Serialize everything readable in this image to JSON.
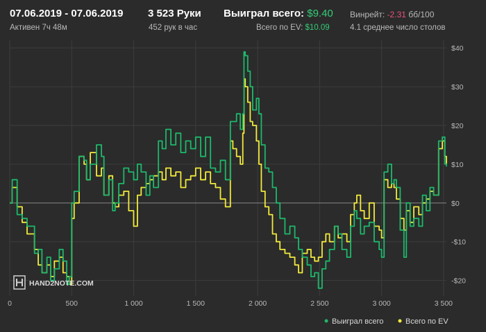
{
  "header": {
    "date_range": "07.06.2019 - 07.06.2019",
    "active": "Активен 7ч 48м",
    "hands": "3 523 Руки",
    "hands_per_hour": "452 рук в час",
    "won_label": "Выиграл всего:",
    "won_value": "$9.40",
    "ev_label": "Всего по EV:",
    "ev_value": "$10.09",
    "winrate_label": "Винрейт:",
    "winrate_value": "-2.31",
    "winrate_unit": "бб/100",
    "avg_tables": "4.1 среднее число столов"
  },
  "watermark": "HAND2NOTE.COM",
  "colors": {
    "won": "#1db86b",
    "ev": "#f2ea3c",
    "background": "#2b2b2b",
    "grid": "#3d3d3d",
    "zero_line": "#8a8a8a"
  },
  "chart_data": {
    "type": "line",
    "xlim": [
      0,
      3523
    ],
    "ylim": [
      -24,
      42
    ],
    "x_ticks": [
      {
        "value": 0,
        "label": "0"
      },
      {
        "value": 500,
        "label": "500"
      },
      {
        "value": 1000,
        "label": "1 000"
      },
      {
        "value": 1500,
        "label": "1 500"
      },
      {
        "value": 2000,
        "label": "2 000"
      },
      {
        "value": 2500,
        "label": "2 500"
      },
      {
        "value": 3000,
        "label": "3 000"
      },
      {
        "value": 3500,
        "label": "3 500"
      }
    ],
    "y_ticks": [
      {
        "value": 40,
        "label": "$40"
      },
      {
        "value": 30,
        "label": "$30"
      },
      {
        "value": 20,
        "label": "$20"
      },
      {
        "value": 10,
        "label": "$10"
      },
      {
        "value": 0,
        "label": "$0"
      },
      {
        "value": -10,
        "label": "-$10"
      },
      {
        "value": -20,
        "label": "-$20"
      }
    ],
    "legend_position": "bottom-right",
    "series": [
      {
        "name": "Выиграл всего",
        "x": [
          0,
          20,
          60,
          100,
          140,
          200,
          230,
          260,
          300,
          330,
          360,
          400,
          430,
          460,
          480,
          500,
          520,
          560,
          600,
          620,
          650,
          700,
          740,
          760,
          800,
          830,
          850,
          880,
          920,
          960,
          1000,
          1030,
          1060,
          1100,
          1130,
          1160,
          1200,
          1230,
          1260,
          1300,
          1340,
          1380,
          1420,
          1460,
          1500,
          1540,
          1580,
          1620,
          1660,
          1700,
          1740,
          1780,
          1800,
          1830,
          1860,
          1880,
          1890,
          1900,
          1920,
          1940,
          1960,
          1990,
          2010,
          2030,
          2060,
          2090,
          2120,
          2150,
          2180,
          2220,
          2260,
          2300,
          2330,
          2360,
          2400,
          2430,
          2460,
          2490,
          2520,
          2550,
          2580,
          2620,
          2650,
          2680,
          2720,
          2750,
          2780,
          2800,
          2830,
          2860,
          2900,
          2940,
          2980,
          3000,
          3020,
          3050,
          3080,
          3100,
          3120,
          3150,
          3180,
          3200,
          3230,
          3260,
          3300,
          3330,
          3360,
          3390,
          3420,
          3460,
          3490,
          3510,
          3523
        ],
        "values": [
          0,
          6,
          -3,
          -4,
          -6,
          -13,
          -12,
          -18,
          -14,
          -20,
          -17,
          -12,
          -15,
          -21,
          -19,
          0,
          3,
          12,
          11,
          6,
          10,
          15,
          12,
          2,
          6,
          -2,
          0,
          5,
          9,
          8,
          6,
          10,
          8,
          2,
          7,
          4,
          16,
          14,
          19,
          15,
          18,
          13,
          16,
          14,
          17,
          12,
          17,
          9,
          8,
          11,
          6,
          21,
          21,
          23,
          19,
          23,
          39,
          38,
          34,
          30,
          24,
          27,
          23,
          15,
          9,
          8,
          4,
          0,
          -4,
          -8,
          -6,
          -9,
          -12,
          -14,
          -16,
          -19,
          -18,
          -22,
          -17,
          -15,
          -12,
          -6,
          -8,
          -12,
          -14,
          -6,
          -2,
          -4,
          -8,
          -6,
          -5,
          -10,
          -12,
          -14,
          8,
          10,
          5,
          6,
          4,
          -7,
          -14,
          0,
          -6,
          -4,
          -6,
          2,
          -2,
          4,
          2,
          16,
          17,
          10,
          9.4
        ]
      },
      {
        "name": "Всего по EV",
        "x": [
          0,
          20,
          60,
          100,
          140,
          200,
          230,
          260,
          300,
          330,
          360,
          400,
          430,
          460,
          480,
          500,
          520,
          560,
          600,
          620,
          650,
          700,
          740,
          760,
          800,
          830,
          850,
          880,
          920,
          960,
          1000,
          1030,
          1060,
          1100,
          1130,
          1160,
          1200,
          1230,
          1260,
          1300,
          1340,
          1380,
          1420,
          1460,
          1500,
          1540,
          1580,
          1620,
          1660,
          1700,
          1740,
          1780,
          1800,
          1830,
          1860,
          1880,
          1890,
          1900,
          1920,
          1940,
          1960,
          1990,
          2010,
          2030,
          2060,
          2090,
          2120,
          2150,
          2180,
          2220,
          2260,
          2300,
          2330,
          2360,
          2400,
          2430,
          2460,
          2490,
          2520,
          2550,
          2580,
          2620,
          2650,
          2680,
          2720,
          2750,
          2780,
          2800,
          2830,
          2860,
          2900,
          2940,
          2980,
          3000,
          3020,
          3050,
          3080,
          3100,
          3120,
          3150,
          3180,
          3200,
          3230,
          3260,
          3300,
          3330,
          3360,
          3390,
          3420,
          3460,
          3490,
          3510,
          3523
        ],
        "values": [
          0,
          4,
          -1,
          -5,
          -8,
          -12,
          -16,
          -18,
          -16,
          -19,
          -15,
          -14,
          -18,
          -19,
          -21,
          -4,
          0,
          12,
          10,
          6,
          13,
          7,
          9,
          2,
          7,
          0,
          -1,
          2,
          3,
          -2,
          -6,
          2,
          4,
          5,
          6,
          7,
          8,
          6,
          9,
          7,
          8,
          4,
          6,
          7,
          9,
          6,
          8,
          5,
          4,
          1,
          -1,
          16,
          14,
          12,
          10,
          18,
          32,
          30,
          26,
          21,
          20,
          16,
          10,
          3,
          -1,
          -3,
          -8,
          -10,
          -12,
          -13,
          -14,
          -16,
          -18,
          -13,
          -12,
          -14,
          -15,
          -14,
          -10,
          -8,
          -10,
          -6,
          -9,
          -8,
          -10,
          -3,
          0,
          2,
          -2,
          -4,
          0,
          -6,
          -7,
          -9,
          6,
          4,
          5,
          4,
          1,
          -4,
          -7,
          -2,
          -5,
          -1,
          -3,
          0,
          1,
          3,
          2,
          14,
          16,
          12,
          10.09
        ]
      }
    ]
  }
}
